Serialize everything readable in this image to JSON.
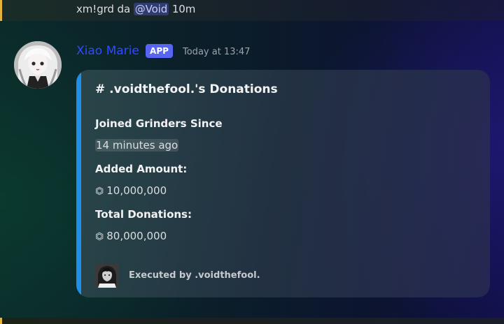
{
  "previous_message": {
    "text_before": "xm!grd da ",
    "mention": "@Void",
    "text_after": " 10m"
  },
  "message": {
    "author": "Xiao Marie",
    "badge": "APP",
    "timestamp": "Today at 13:47",
    "avatar_icon": "anime-girl-avatar",
    "embed": {
      "accent_color": "#1f8fea",
      "title": "# .voidthefool.'s Donations",
      "fields": [
        {
          "name": "Joined Grinders Since",
          "value": "14 minutes ago"
        },
        {
          "name": "Added Amount:",
          "value": "10,000,000",
          "icon": "coin-icon"
        },
        {
          "name": "Total Donations:",
          "value": "80,000,000",
          "icon": "coin-icon"
        }
      ],
      "footer": {
        "icon": "user-avatar-icon",
        "text": "Executed by .voidthefool."
      }
    }
  },
  "colors": {
    "username": "#3449ff",
    "badge_bg": "#5865f2",
    "mention_bg": "#5865f2",
    "highlight_bar": "#e6b43a"
  }
}
